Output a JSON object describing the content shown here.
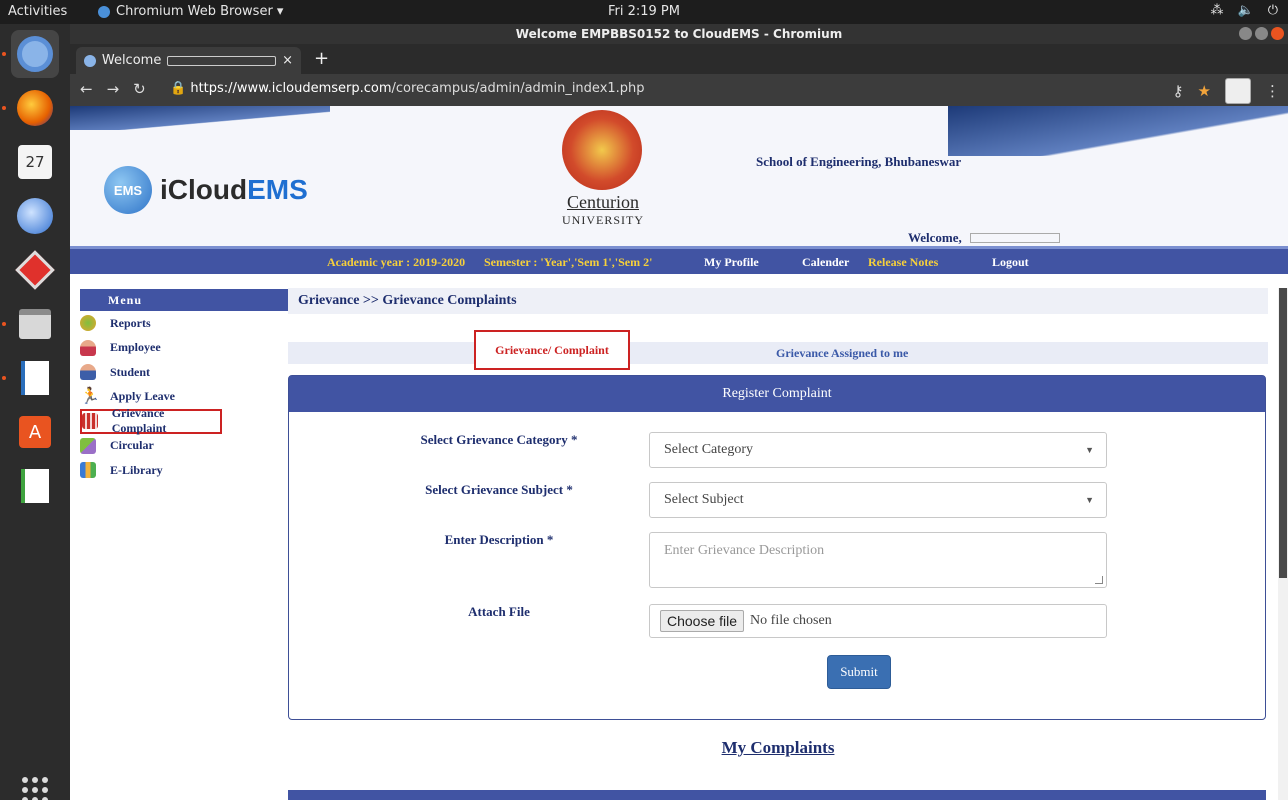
{
  "os_bar": {
    "activities": "Activities",
    "app_menu": "Chromium Web Browser ▾",
    "clock": "Fri  2:19 PM"
  },
  "window": {
    "title": "Welcome EMPBBS0152 to CloudEMS - Chromium",
    "tab_label": "Welcome",
    "url_host": "https://www.icloudemserp.com",
    "url_path": "/corecampus/admin/admin_index1.php"
  },
  "header": {
    "brand_prefix": "iCloud",
    "brand_suffix": "EMS",
    "logo_badge": "EMS",
    "university_line1": "Centurion",
    "university_line2": "UNIVERSITY",
    "school": "School of Engineering, Bhubaneswar",
    "welcome": "Welcome,"
  },
  "navbar": {
    "academic_year": "Academic year : 2019-2020",
    "semester": "Semester : 'Year','Sem 1','Sem 2'",
    "my_profile": "My Profile",
    "calender": "Calender",
    "release_notes": "Release Notes",
    "logout": "Logout"
  },
  "sidebar": {
    "heading": "Menu",
    "items": [
      {
        "label": "Reports"
      },
      {
        "label": "Employee"
      },
      {
        "label": "Student"
      },
      {
        "label": "Apply Leave"
      },
      {
        "label": "Grievance Complaint"
      },
      {
        "label": "Circular"
      },
      {
        "label": "E-Library"
      }
    ]
  },
  "breadcrumb": "Grievance >> Grievance Complaints",
  "tabs": {
    "complaint": "Grievance/ Complaint",
    "assigned": "Grievance Assigned to me"
  },
  "form": {
    "heading": "Register Complaint",
    "category_label": "Select Grievance Category *",
    "category_value": "Select Category",
    "subject_label": "Select Grievance Subject *",
    "subject_value": "Select Subject",
    "description_label": "Enter Description *",
    "description_placeholder": "Enter Grievance Description",
    "attach_label": "Attach File",
    "choose_file": "Choose file",
    "no_file": "No file chosen",
    "submit": "Submit"
  },
  "my_complaints": "My Complaints",
  "colors": {
    "nav_blue": "#4154a3",
    "highlight_red": "#cc2222",
    "nav_yellow": "#f6d03b",
    "ubuntu_orange": "#e95420"
  }
}
